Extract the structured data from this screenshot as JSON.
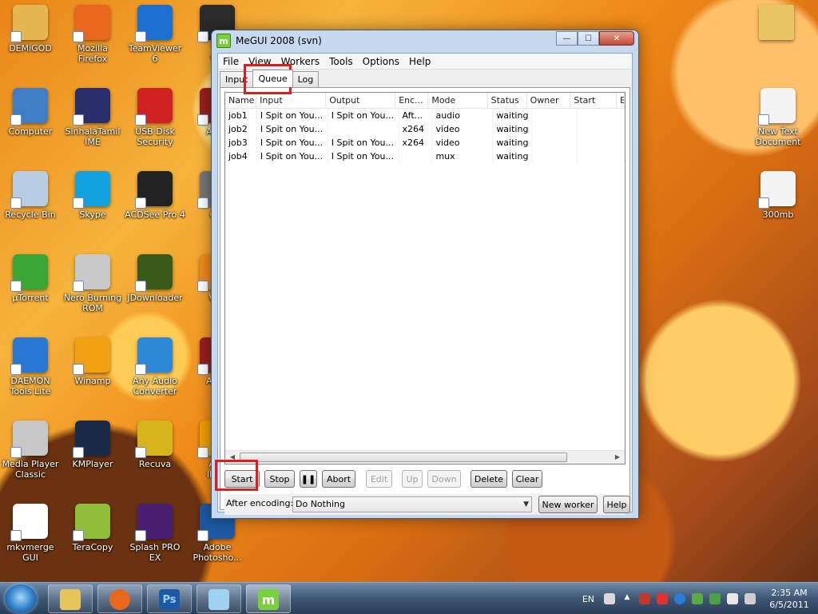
{
  "desktop": {
    "icons": [
      {
        "label": "DEMiGOD",
        "color": "#e6b650"
      },
      {
        "label": "Mozilla\nFirefox",
        "color": "#e8671c"
      },
      {
        "label": "TeamViewer 6",
        "color": "#1d6fd1"
      },
      {
        "label": "TM\nVid",
        "color": "#2b2b2b"
      },
      {
        "label": "Computer",
        "color": "#3f7dc4"
      },
      {
        "label": "SinhalaTamil\nIME",
        "color": "#2a2e6b"
      },
      {
        "label": "USB Disk\nSecurity",
        "color": "#d02222"
      },
      {
        "label": "Adob",
        "color": "#9a1f1f"
      },
      {
        "label": "Recycle Bin",
        "color": "#b7cde4"
      },
      {
        "label": "Skype",
        "color": "#12a2e0"
      },
      {
        "label": "ACDSee Pro 4",
        "color": "#222222"
      },
      {
        "label": "Qui\nP",
        "color": "#777777"
      },
      {
        "label": "µTorrent",
        "color": "#3aa633"
      },
      {
        "label": "Nero Burning\nROM",
        "color": "#c9c9c9"
      },
      {
        "label": "JDownloader",
        "color": "#3a5a1a"
      },
      {
        "label": "VLC\nP",
        "color": "#ef8b1a"
      },
      {
        "label": "DAEMON\nTools Lite",
        "color": "#2a78d6"
      },
      {
        "label": "Winamp",
        "color": "#f0a010"
      },
      {
        "label": "Any Audio\nConverter",
        "color": "#2d88d8"
      },
      {
        "label": "Adob",
        "color": "#9a1f1f"
      },
      {
        "label": "Media Player\nClassic",
        "color": "#c7c7c7"
      },
      {
        "label": "KMPlayer",
        "color": "#1c2a4a"
      },
      {
        "label": "Recuva",
        "color": "#d7b31c"
      },
      {
        "label": "Ado\nIllust",
        "color": "#f0a000"
      },
      {
        "label": "mkvmerge\nGUI",
        "color": "#ffffff"
      },
      {
        "label": "TeraCopy",
        "color": "#8fbd3a"
      },
      {
        "label": "Splash PRO\nEX",
        "color": "#4a1e72"
      },
      {
        "label": "Adobe\nPhotosho...",
        "color": "#1d5aa3"
      },
      {
        "label": "New Text\nDocument",
        "color": "#f4f4f4"
      },
      {
        "label": "300mb",
        "color": "#f4f4f4"
      }
    ],
    "folder_color": "#e9c563"
  },
  "window": {
    "title": "MeGUI 2008 (svn)",
    "app_icon": "m",
    "controls": {
      "minimize": "—",
      "maximize": "☐",
      "close": "✕"
    }
  },
  "menu": [
    "File",
    "View",
    "Workers",
    "Tools",
    "Options",
    "Help"
  ],
  "tabs": [
    "Input",
    "Queue",
    "Log"
  ],
  "active_tab": "Queue",
  "queue": {
    "columns": [
      "Name",
      "Input",
      "Output",
      "Enc...",
      "Mode",
      "Status",
      "Owner",
      "Start",
      "E"
    ],
    "rows": [
      [
        "job1",
        "I Spit on You...",
        "I Spit on You...",
        "Aft...",
        "audio",
        "waiting",
        "",
        ""
      ],
      [
        "job2",
        "I Spit on You...",
        "",
        "x264",
        "video",
        "waiting",
        "",
        ""
      ],
      [
        "job3",
        "I Spit on You...",
        "I Spit on You...",
        "x264",
        "video",
        "waiting",
        "",
        ""
      ],
      [
        "job4",
        "I Spit on You...",
        "I Spit on You...",
        "",
        "mux",
        "waiting",
        "",
        ""
      ]
    ]
  },
  "buttons": {
    "start": "Start",
    "stop": "Stop",
    "pause": "❚❚",
    "abort": "Abort",
    "edit": "Edit",
    "up": "Up",
    "down": "Down",
    "delete": "Delete",
    "clear": "Clear",
    "new_worker": "New worker",
    "help": "Help"
  },
  "after_encoding": {
    "label": "After encoding:",
    "value": "Do Nothing"
  },
  "annotation_color": "#e11b22",
  "taskbar": {
    "apps": [
      {
        "name": "explorer",
        "color": "#e7c45a"
      },
      {
        "name": "firefox",
        "color": "#e8671c"
      },
      {
        "name": "photoshop",
        "color": "#1d5aa3",
        "text": "Ps"
      },
      {
        "name": "notepad",
        "color": "#9fd1f0"
      },
      {
        "name": "megui",
        "color": "#7ad03a",
        "text": "m"
      }
    ],
    "language": "EN",
    "time": "2:35 AM",
    "date": "6/5/2011"
  }
}
